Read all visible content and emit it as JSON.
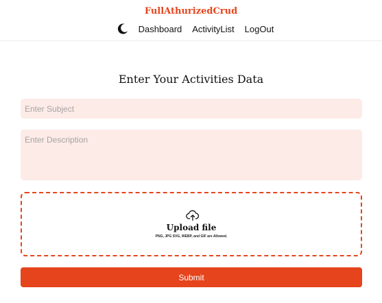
{
  "header": {
    "brand": "FullAthurizedCrud",
    "theme_toggle_icon": "moon-icon",
    "nav": [
      {
        "label": "Dashboard"
      },
      {
        "label": "ActivityList"
      },
      {
        "label": "LogOut"
      }
    ]
  },
  "form": {
    "title": "Enter Your Activities Data",
    "subject": {
      "placeholder": "Enter Subject",
      "value": ""
    },
    "description": {
      "placeholder": "Enter Description",
      "value": ""
    },
    "upload": {
      "icon": "upload-cloud-icon",
      "title": "Upload file",
      "hint": "PNG, JPG SVG, WEBP, and GIF are Allowed."
    },
    "submit_label": "Submit"
  },
  "colors": {
    "accent": "#e5441c",
    "input_background": "#fcebe7"
  }
}
